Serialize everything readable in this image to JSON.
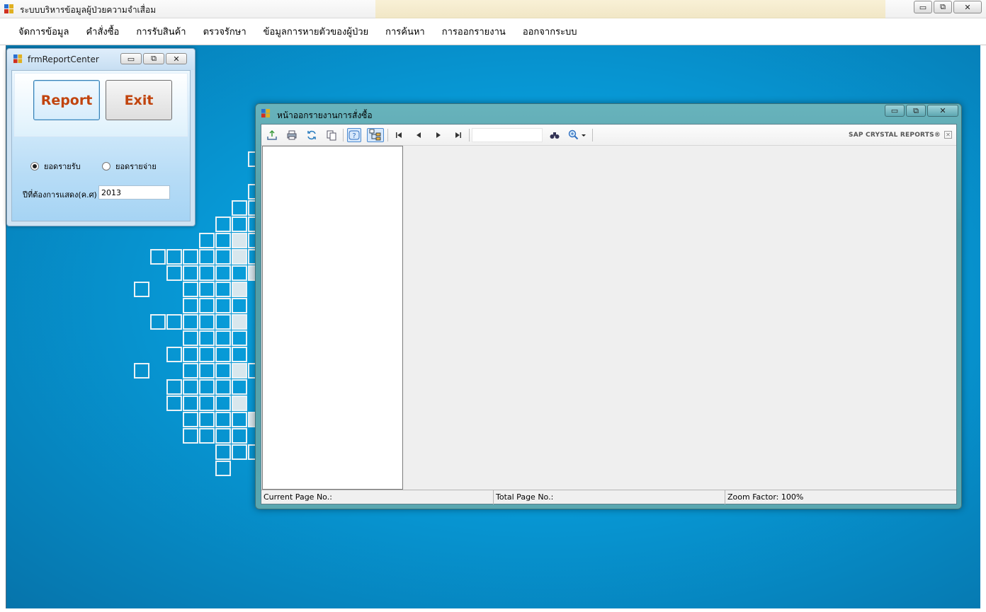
{
  "main_window": {
    "title": "ระบบบริหารข้อมูลผู้ป่วยความจำเสื่อม",
    "min_glyph": "▭",
    "max_glyph": "⧉",
    "close_glyph": "✕"
  },
  "menu": {
    "items": [
      "จัดการข้อมูล",
      "คำสั่งซื้อ",
      "การรับสินค้า",
      "ตรวจรักษา",
      "ข้อมูลการหายตัวของผู้ป่วย",
      "การค้นหา",
      "การออกรายงาน",
      "ออกจากระบบ"
    ]
  },
  "report_center": {
    "title": "frmReportCenter",
    "report_button": "Report",
    "exit_button": "Exit",
    "radio_income": "ยอดรายรับ",
    "radio_expense": "ยอดรายจ่าย",
    "selected_radio": "income",
    "year_label": "ปีที่ต้องการแสดง(ค.ศ)",
    "year_value": "2013"
  },
  "report_viewer": {
    "title": "หน้าออกรายงานการสั่งซื้อ",
    "brand": "SAP CRYSTAL REPORTS®",
    "status": {
      "current_page": "Current Page No.:",
      "total_page": "Total Page No.:",
      "zoom": "Zoom Factor: 100%"
    },
    "toolbar_icons": [
      "export-icon",
      "print-icon",
      "refresh-icon",
      "copy-icon",
      "help-icon",
      "group-tree-toggle-icon",
      "first-page-icon",
      "previous-page-icon",
      "next-page-icon",
      "last-page-icon",
      "find-icon",
      "zoom-icon"
    ]
  },
  "colors": {
    "desktop_blue": "#0799d6",
    "button_text": "#c1440e",
    "viewer_frame": "#5aa7b0"
  }
}
